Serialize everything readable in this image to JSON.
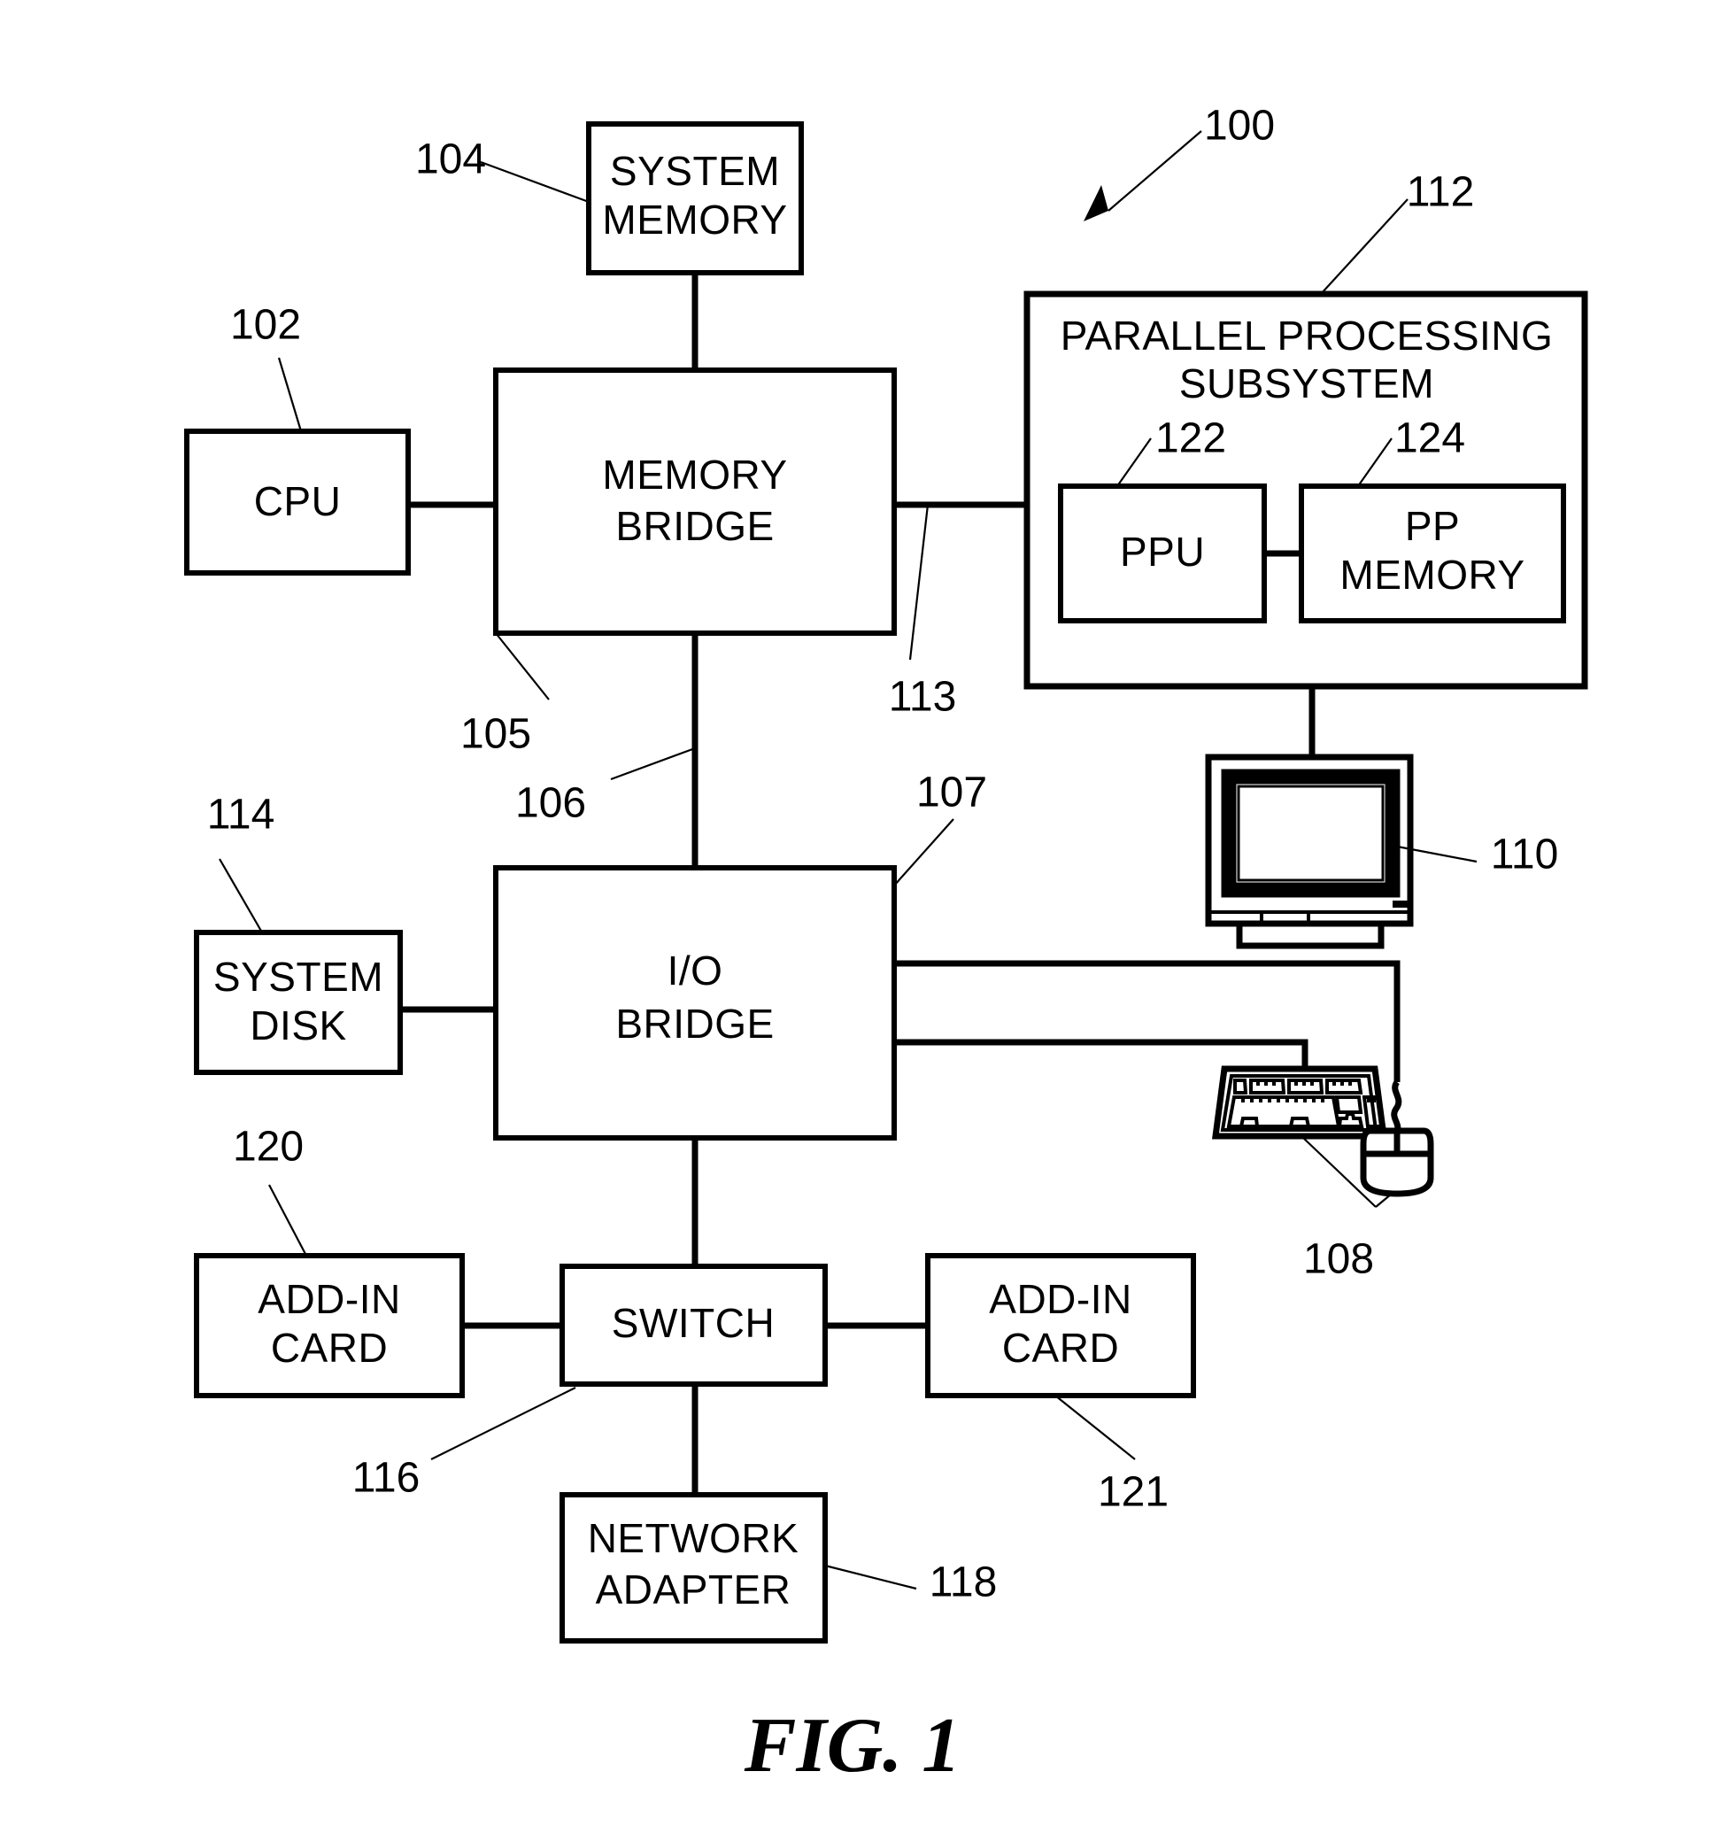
{
  "figure": {
    "caption": "FIG. 1",
    "system_ref": "100"
  },
  "blocks": [
    {
      "id": "system-memory",
      "label_lines": [
        "SYSTEM",
        "MEMORY"
      ],
      "ref": "104"
    },
    {
      "id": "cpu",
      "label_lines": [
        "CPU"
      ],
      "ref": "102"
    },
    {
      "id": "memory-bridge",
      "label_lines": [
        "MEMORY",
        "BRIDGE"
      ],
      "ref": "105"
    },
    {
      "id": "parallel-processing-subsystem",
      "label_lines": [
        "PARALLEL PROCESSING",
        "SUBSYSTEM"
      ],
      "ref": "112"
    },
    {
      "id": "ppu",
      "label_lines": [
        "PPU"
      ],
      "ref": "122"
    },
    {
      "id": "pp-memory",
      "label_lines": [
        "PP",
        "MEMORY"
      ],
      "ref": "124"
    },
    {
      "id": "io-bridge",
      "label_lines": [
        "I/O",
        "BRIDGE"
      ],
      "ref": "107"
    },
    {
      "id": "system-disk",
      "label_lines": [
        "SYSTEM",
        "DISK"
      ],
      "ref": "114"
    },
    {
      "id": "add-in-card-left",
      "label_lines": [
        "ADD-IN",
        "CARD"
      ],
      "ref": "120"
    },
    {
      "id": "switch",
      "label_lines": [
        "SWITCH"
      ],
      "ref": "116"
    },
    {
      "id": "add-in-card-right",
      "label_lines": [
        "ADD-IN",
        "CARD"
      ],
      "ref": "121"
    },
    {
      "id": "network-adapter",
      "label_lines": [
        "NETWORK",
        "ADAPTER"
      ],
      "ref": "118"
    }
  ],
  "devices": [
    {
      "id": "display-device",
      "name": "monitor-icon",
      "ref": "110"
    },
    {
      "id": "input-devices",
      "name": "keyboard-and-mouse-icon",
      "ref": "108"
    }
  ],
  "connection_refs": [
    {
      "id": "memory-bridge-to-pps-path",
      "ref": "113"
    },
    {
      "id": "memory-bridge-to-io-bridge-path",
      "ref": "106"
    }
  ],
  "labels": {
    "system_memory_l1": "SYSTEM",
    "system_memory_l2": "MEMORY",
    "cpu": "CPU",
    "memory_bridge_l1": "MEMORY",
    "memory_bridge_l2": "BRIDGE",
    "pps_l1": "PARALLEL PROCESSING",
    "pps_l2": "SUBSYSTEM",
    "ppu": "PPU",
    "pp_memory_l1": "PP",
    "pp_memory_l2": "MEMORY",
    "io_bridge_l1": "I/O",
    "io_bridge_l2": "BRIDGE",
    "system_disk_l1": "SYSTEM",
    "system_disk_l2": "DISK",
    "add_in_card_left_l1": "ADD-IN",
    "add_in_card_left_l2": "CARD",
    "switch": "SWITCH",
    "add_in_card_right_l1": "ADD-IN",
    "add_in_card_right_l2": "CARD",
    "network_adapter_l1": "NETWORK",
    "network_adapter_l2": "ADAPTER"
  },
  "refs": {
    "r100": "100",
    "r102": "102",
    "r104": "104",
    "r105": "105",
    "r106": "106",
    "r107": "107",
    "r108": "108",
    "r110": "110",
    "r112": "112",
    "r113": "113",
    "r114": "114",
    "r116": "116",
    "r118": "118",
    "r120": "120",
    "r121": "121",
    "r122": "122",
    "r124": "124"
  },
  "colors": {
    "ink": "#000000",
    "paper": "#ffffff"
  }
}
